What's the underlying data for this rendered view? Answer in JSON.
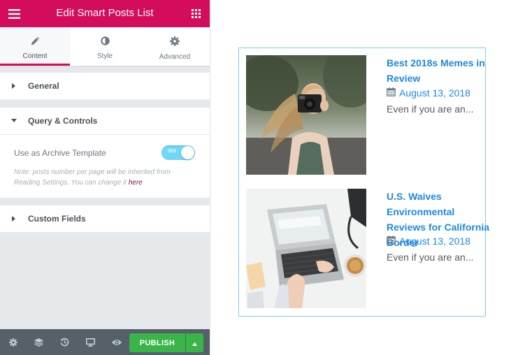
{
  "panel": {
    "title": "Edit Smart Posts List",
    "header_icons": {
      "left": "hamburger-menu-icon",
      "right": "grid-apps-icon"
    },
    "tabs": [
      {
        "label": "Content",
        "icon": "pencil-icon",
        "active": true
      },
      {
        "label": "Style",
        "icon": "half-circle-icon",
        "active": false
      },
      {
        "label": "Advanced",
        "icon": "gear-icon",
        "active": false
      }
    ],
    "sections": {
      "general": {
        "title": "General",
        "expanded": false
      },
      "query": {
        "title": "Query & Controls",
        "expanded": true,
        "archive_label": "Use as Archive Template",
        "archive_toggle": "YES",
        "note_text": "Note: posts number per page will be inherited from Reading Settings. You can change it ",
        "note_link": "here"
      },
      "custom_fields": {
        "title": "Custom Fields",
        "expanded": false
      }
    },
    "footer": {
      "icons": [
        "settings-icon",
        "layers-icon",
        "history-icon",
        "responsive-desktop-icon",
        "preview-eye-icon"
      ],
      "publish_label": "PUBLISH"
    },
    "colors": {
      "brand": "#d30c5c",
      "publish": "#39b54a",
      "footer": "#556068",
      "toggle": "#71d7f7"
    }
  },
  "preview": {
    "border_color": "#7fd3dd",
    "link_color": "#1e88e5",
    "posts": [
      {
        "title": "Best 2018s Memes in Review",
        "date": "August 13, 2018",
        "excerpt": "Even if you are an...",
        "image": "woman-with-camera-photo"
      },
      {
        "title": "U.S. Waives Environmental Reviews for California Border",
        "date": "August 13, 2018",
        "excerpt": "Even if you are an...",
        "image": "laptop-desk-photo"
      }
    ]
  }
}
